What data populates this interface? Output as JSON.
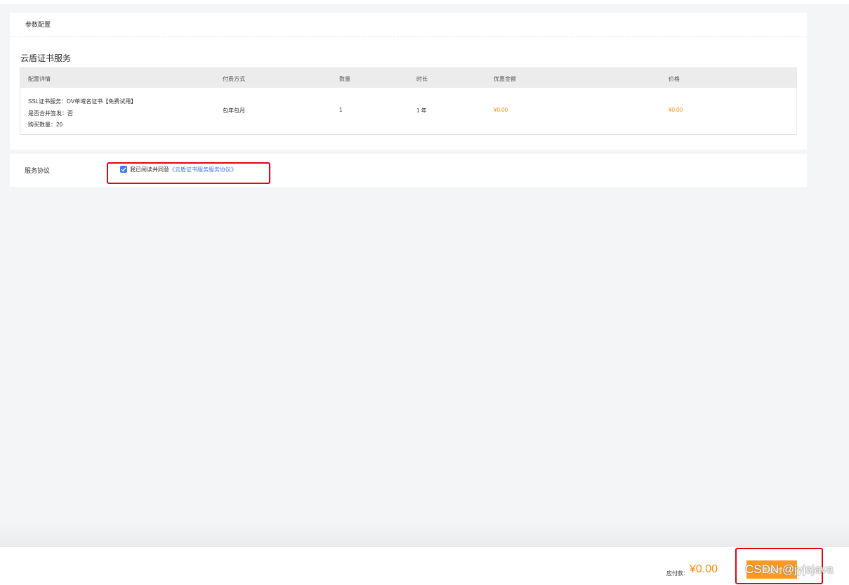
{
  "config_section": {
    "header": "参数配置",
    "service_title": "云盾证书服务",
    "table": {
      "headers": {
        "detail": "配置详情",
        "payment": "付费方式",
        "quantity": "数量",
        "duration": "时长",
        "discount": "优惠金额",
        "price": "价格"
      },
      "row": {
        "detail_lines": [
          "SSL证书服务：DV单域名证书【免费试用】",
          "是否合并签发：否",
          "购买数量：20"
        ],
        "payment": "包年包月",
        "quantity": "1",
        "duration": "1 年",
        "discount": "¥0.00",
        "price": "¥0.00"
      }
    }
  },
  "agreement_section": {
    "label": "服务协议",
    "checked": true,
    "agree_text": "我已阅读并同意",
    "agree_link": "《云盾证书服务服务协议》"
  },
  "footer": {
    "pay_label": "应付款：",
    "pay_amount": "¥0.00",
    "submit_label": "去支付",
    "watermark": "CSDN @jyjsjava"
  },
  "colors": {
    "accent_orange": "#ff8a00",
    "link_blue": "#3c7bf6",
    "highlight_red": "#e60012"
  }
}
